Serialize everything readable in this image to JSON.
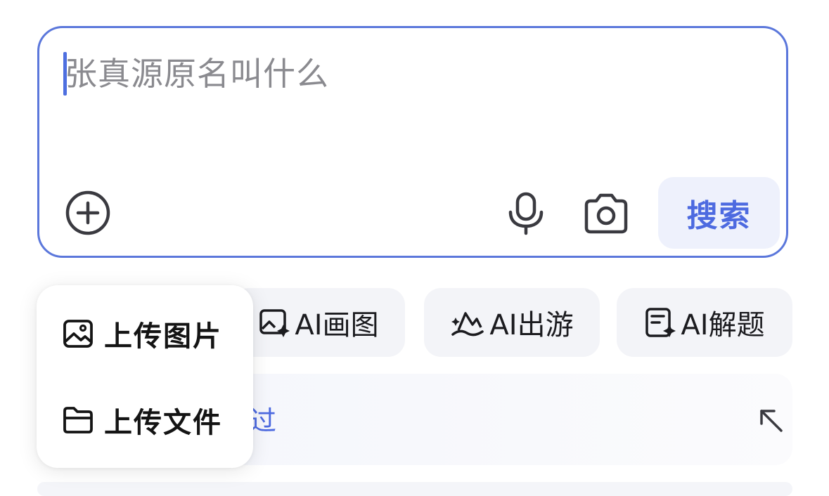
{
  "search": {
    "query": "张真源原名叫什么",
    "submit_label": "搜索",
    "icons": {
      "add": "plus-circle-icon",
      "voice": "microphone-icon",
      "camera": "camera-icon"
    }
  },
  "chips": [
    {
      "label": "AI画图",
      "icon": "image-sparkle-icon"
    },
    {
      "label": "AI出游",
      "icon": "mountain-sun-icon"
    },
    {
      "label": "AI解题",
      "icon": "document-sparkle-icon"
    }
  ],
  "tip": {
    "link_text": "过",
    "expand_icon": "arrow-up-left-icon"
  },
  "popup_menu": {
    "items": [
      {
        "label": "上传图片",
        "icon": "image-icon"
      },
      {
        "label": "上传文件",
        "icon": "folder-icon"
      }
    ]
  },
  "colors": {
    "accent": "#4d6ae0",
    "border": "#5b77db",
    "chip_bg": "#f3f4f8"
  }
}
